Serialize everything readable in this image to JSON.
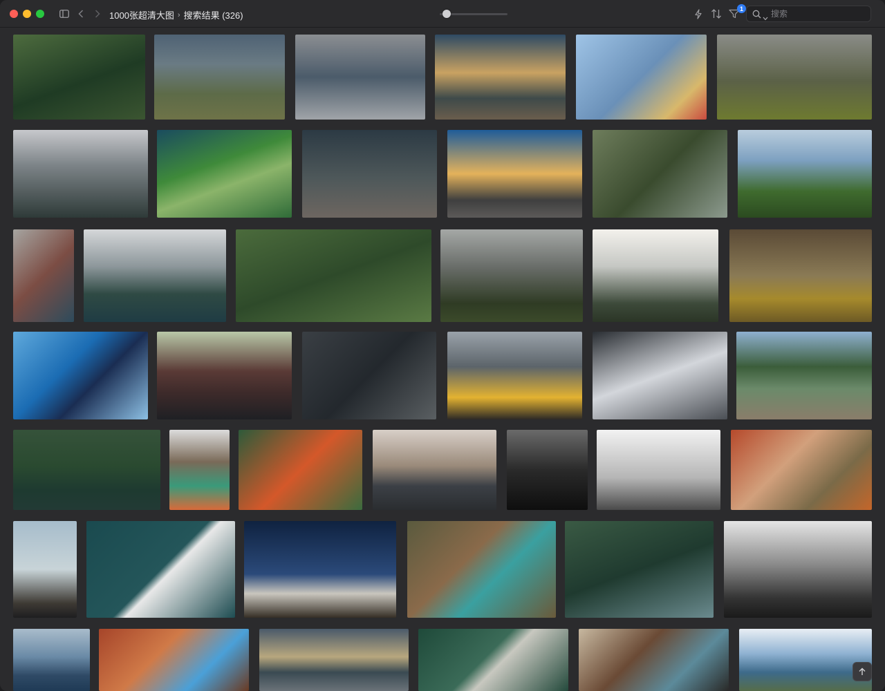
{
  "window": {
    "title": "1000张超清大图",
    "subtitle": "搜索结果 (326)"
  },
  "toolbar": {
    "icons": [
      "sidebar-icon",
      "chevron-left-icon",
      "chevron-right-icon",
      "lightning-icon",
      "sort-icon",
      "filter-icon",
      "search-icon",
      "chevron-down-icon"
    ],
    "filter_badge": "1",
    "zoom_level": 0.1
  },
  "search": {
    "placeholder": "搜索"
  },
  "colors": {
    "close": "#ff5f57",
    "minimize": "#febc2e",
    "zoom": "#28c840",
    "accent": "#2f7cf6",
    "background": "#2b2b2d"
  },
  "gallery": {
    "images": [
      {
        "subject": "funicular railway through jungle"
      },
      {
        "subject": "mountain valley with clouds"
      },
      {
        "subject": "busy train station crowd"
      },
      {
        "subject": "sunset over mountain ridge"
      },
      {
        "subject": "painter with paint cans"
      },
      {
        "subject": "lone tree in misty field"
      },
      {
        "subject": "misty mountain peaks"
      },
      {
        "subject": "aerial green hills with road"
      },
      {
        "subject": "woman holding sparkler"
      },
      {
        "subject": "road at sunset"
      },
      {
        "subject": "deer in forest stream"
      },
      {
        "subject": "castle on forested hill"
      },
      {
        "subject": "hands reaching"
      },
      {
        "subject": "foggy lake and hills"
      },
      {
        "subject": "green tea plantation rows"
      },
      {
        "subject": "fog over forest"
      },
      {
        "subject": "foggy treeline"
      },
      {
        "subject": "golden hillside"
      },
      {
        "subject": "blue cube wall pattern"
      },
      {
        "subject": "mountain road dusk"
      },
      {
        "subject": "dessert on dark table"
      },
      {
        "subject": "yellow taxis in city street"
      },
      {
        "subject": "skyscrapers looking up"
      },
      {
        "subject": "wooden pier on green lake"
      },
      {
        "subject": "forest reflected in lake"
      },
      {
        "subject": "colorful hangers and calendar"
      },
      {
        "subject": "orange tulips"
      },
      {
        "subject": "skateboarder on road"
      },
      {
        "subject": "underwater swimmer"
      },
      {
        "subject": "foggy sea horizon"
      },
      {
        "subject": "autumn forest path"
      },
      {
        "subject": "man on rocky shore"
      },
      {
        "subject": "surfboard in the sea"
      },
      {
        "subject": "starry night over mountains"
      },
      {
        "subject": "floating market boats"
      },
      {
        "subject": "forest river"
      },
      {
        "subject": "misty black and white sea"
      },
      {
        "subject": "ocean with island"
      },
      {
        "subject": "red rock canyon waterfall"
      },
      {
        "subject": "sea waves at dusk"
      },
      {
        "subject": "green bridge underside"
      },
      {
        "subject": "vintage car interior"
      },
      {
        "subject": "fjord under cloudy sky"
      }
    ]
  }
}
